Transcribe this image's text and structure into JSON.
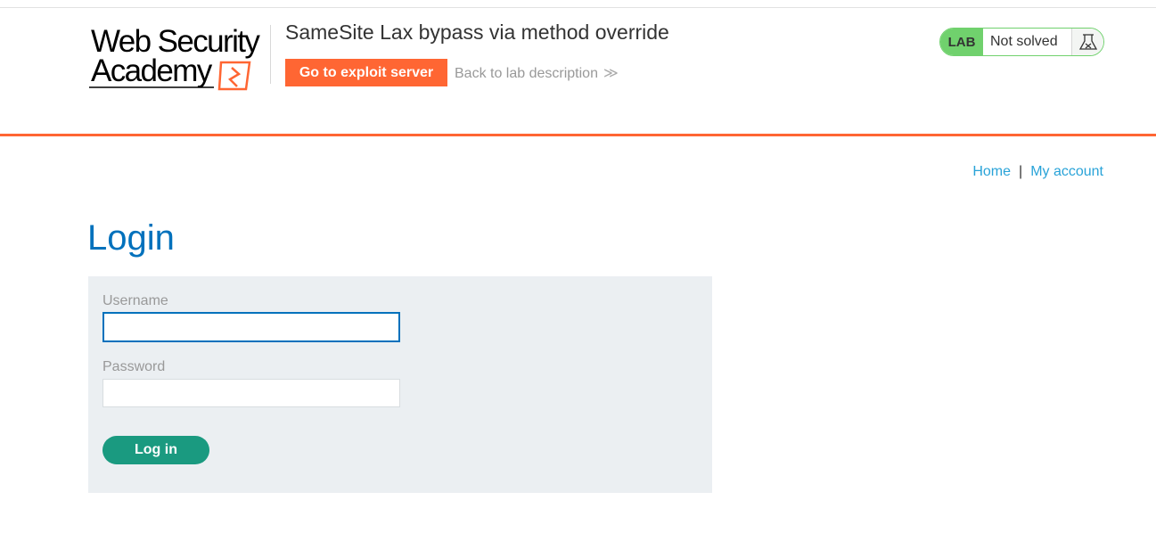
{
  "header": {
    "logo_line1": "Web Security",
    "logo_line2": "Academy",
    "lab_title": "SameSite Lax bypass via method override",
    "exploit_button": "Go to exploit server",
    "back_link": "Back to lab description",
    "back_chevron": "≫",
    "status": {
      "tag": "LAB",
      "text": "Not solved",
      "icon": "flask-icon"
    }
  },
  "nav": {
    "home": "Home",
    "separator": "|",
    "my_account": "My account"
  },
  "login": {
    "title": "Login",
    "username_label": "Username",
    "username_value": "",
    "password_label": "Password",
    "password_value": "",
    "submit": "Log in"
  },
  "colors": {
    "accent_orange": "#ff6633",
    "title_blue": "#0071bc",
    "link_blue": "#29a3d8",
    "status_green": "#70d16d",
    "button_teal": "#1a9a80",
    "panel_gray": "#ebeff2"
  }
}
